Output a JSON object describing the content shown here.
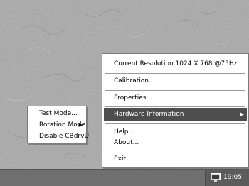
{
  "menu": {
    "resolution": "Current Resolution  1024 X 768 @75Hz",
    "calibration": "Calibration...",
    "properties": "Properties...",
    "hardware_info": "Hardware Information",
    "help": "Help...",
    "about": "About...",
    "exit": "Exit"
  },
  "submenu": {
    "test_mode": "Test Mode...",
    "rotation_mode": "Rotation Mode",
    "disable": "Disable CBdrvU"
  },
  "taskbar": {
    "clock": "19:05",
    "tray_icon": "monitor-tray-icon"
  },
  "colors": {
    "desktop": "#a6a6a6",
    "highlight": "#4d4d4d",
    "taskbar": "#6f6f6f"
  }
}
